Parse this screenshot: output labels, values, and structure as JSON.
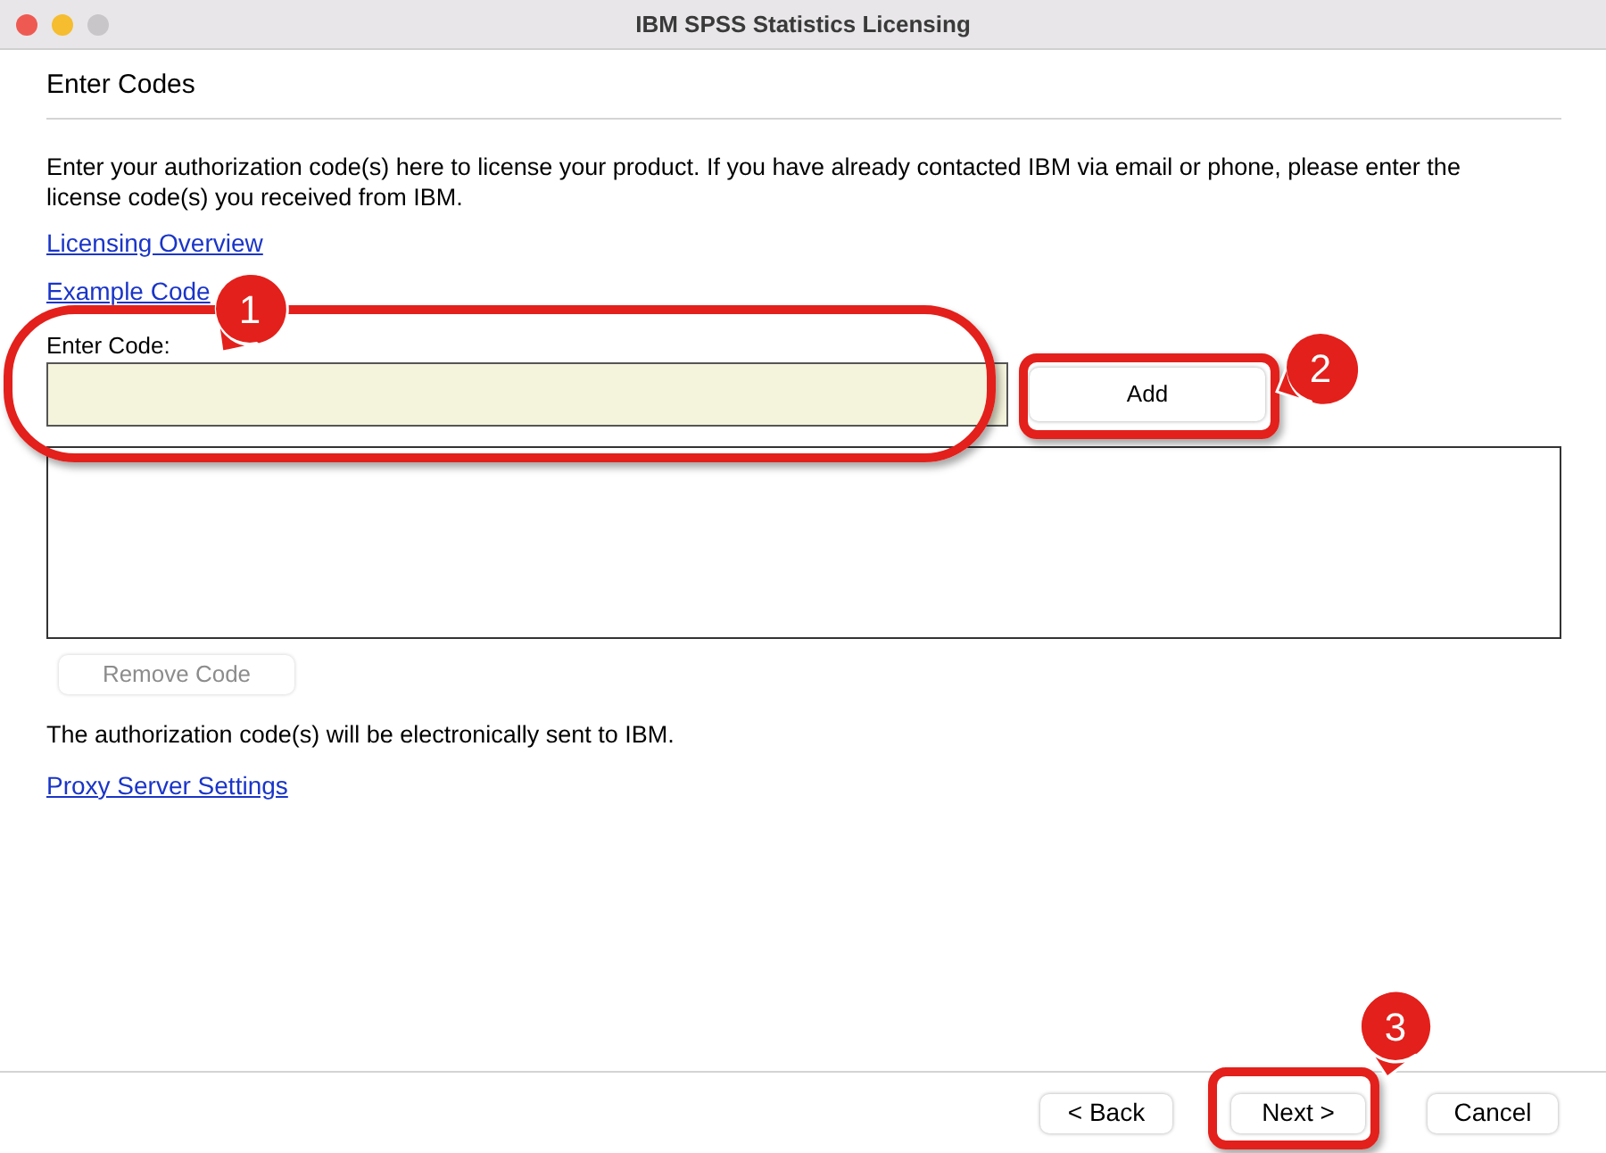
{
  "window": {
    "title": "IBM SPSS Statistics Licensing"
  },
  "heading": "Enter Codes",
  "intro": "Enter your authorization code(s) here to license your product. If you have already contacted IBM via email or phone, please enter the license code(s) you received from IBM.",
  "links": [
    "Licensing Overview",
    "Example Code"
  ],
  "code_field": {
    "label": "Enter Code:"
  },
  "add_button": {
    "label": "Add"
  },
  "remove_button": {
    "label": "Remove Code",
    "disabled": true
  },
  "note": "The authorization code(s) will be electronically sent to IBM.",
  "proxy_link": "Proxy Server Settings",
  "footer_buttons": [
    {
      "label": "< Back"
    },
    {
      "label": "Next >"
    },
    {
      "label": "Cancel"
    }
  ],
  "annotations": [
    {
      "number": "1"
    },
    {
      "number": "2"
    },
    {
      "number": "3"
    }
  ]
}
